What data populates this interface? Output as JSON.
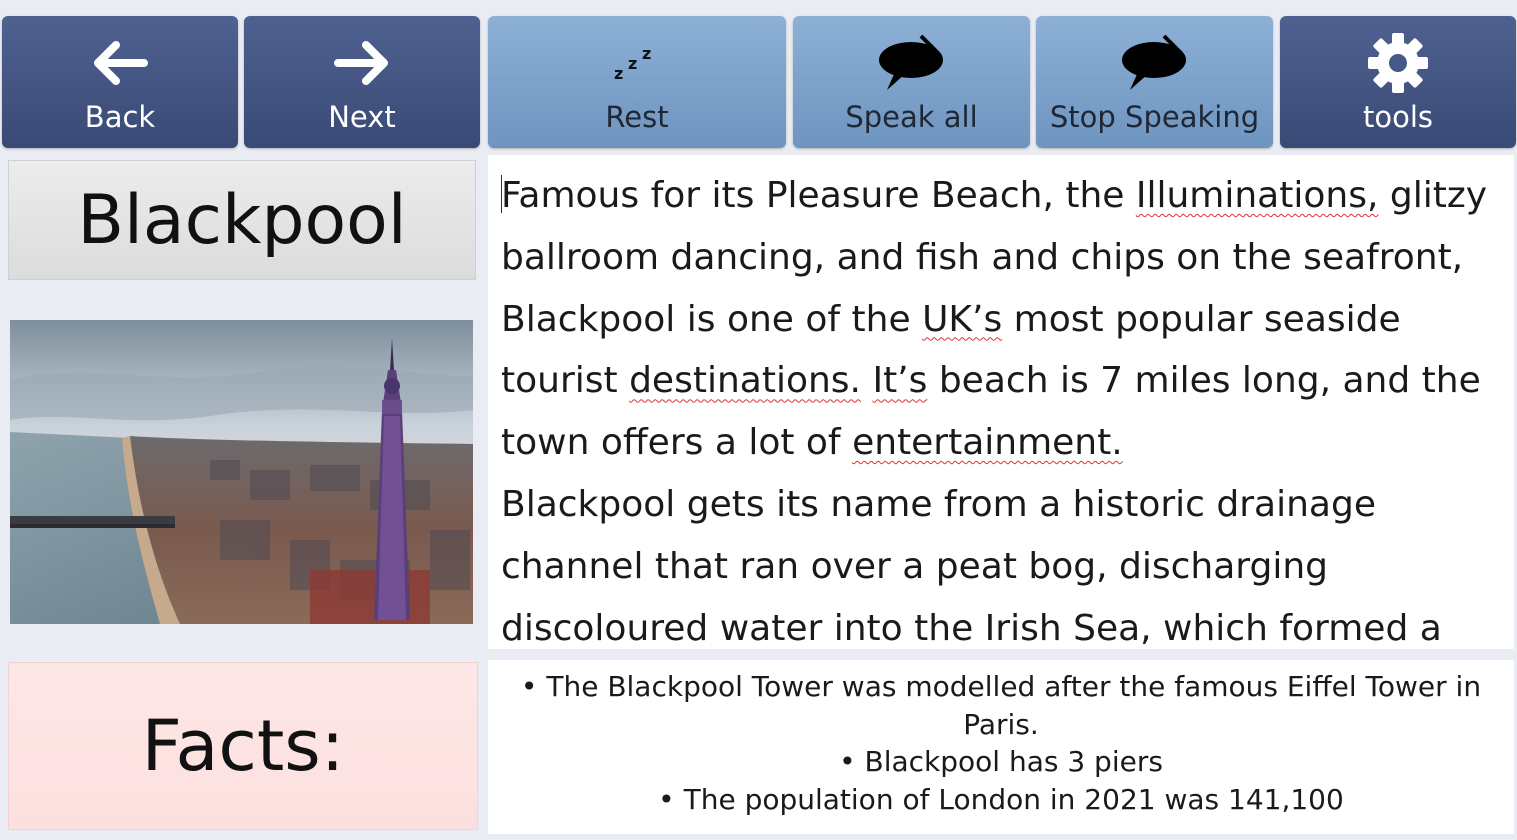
{
  "toolbar": {
    "back_label": "Back",
    "next_label": "Next",
    "rest_label": "Rest",
    "speak_all_label": "Speak all",
    "stop_label": "Stop Speaking",
    "tools_label": "tools",
    "icons": {
      "back": "arrow-left-icon",
      "next": "arrow-right-icon",
      "rest": "sleep-zzz-icon",
      "speak_all": "speech-bubble-icon",
      "stop": "speech-bubble-icon",
      "tools": "gear-icon"
    }
  },
  "title": "Blackpool",
  "photo_alt": "Blackpool Tower aerial view",
  "main_text": {
    "p1": [
      {
        "text": "Famous for its Pleasure Beach, the "
      },
      {
        "text": "Illuminations,",
        "spell": true
      },
      {
        "text": " glitzy ballroom dancing, and fish and chips on the seafront, Blackpool is one of the "
      },
      {
        "text": "UK’s",
        "spell": true
      },
      {
        "text": " most popular seaside tourist "
      },
      {
        "text": "destinations.",
        "spell": true
      },
      {
        "text": " "
      },
      {
        "text": "It’s",
        "spell": true
      },
      {
        "text": " beach is 7 miles long, and the town offers a lot of "
      },
      {
        "text": "entertainment.",
        "spell": true
      }
    ],
    "p2": "Blackpool gets its name from a historic drainage channel that ran over a peat bog, discharging discoloured water into the Irish Sea, which formed a"
  },
  "facts_heading": "Facts:",
  "facts": [
    "• The Blackpool Tower was modelled after the famous Eiffel Tower in Paris.",
    "• Blackpool has 3 piers",
    "• The population of London in 2021 was 141,100"
  ],
  "colors": {
    "toolbar_dark": "#3f4f7c",
    "toolbar_light": "#7ea3cb",
    "background": "#e9edf3",
    "facts_pink": "#fde6e5",
    "title_grey": "#e3e3e3"
  }
}
